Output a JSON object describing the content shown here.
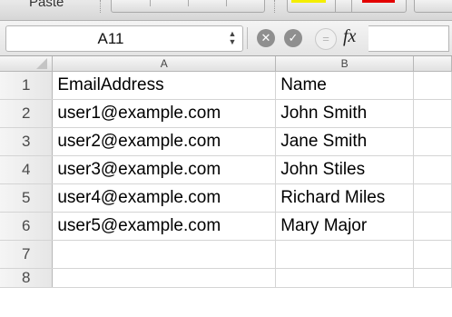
{
  "ribbon": {
    "paste_label": "Paste",
    "swatches": [
      "#f4ee00",
      "#e30000"
    ]
  },
  "formula_bar": {
    "name_box": "A11",
    "icons": [
      "stepper-icon",
      "cancel-icon",
      "enter-icon",
      "equals-icon"
    ],
    "cancel_glyph": "✕",
    "enter_glyph": "✓",
    "equals_glyph": "=",
    "fx_label": "fx",
    "formula_value": ""
  },
  "grid": {
    "columns": [
      "A",
      "B"
    ],
    "rows": [
      {
        "num": "1",
        "cells": [
          "EmailAddress",
          "Name"
        ]
      },
      {
        "num": "2",
        "cells": [
          "user1@example.com",
          "John Smith"
        ]
      },
      {
        "num": "3",
        "cells": [
          "user2@example.com",
          "Jane Smith"
        ]
      },
      {
        "num": "4",
        "cells": [
          "user3@example.com",
          "John Stiles"
        ]
      },
      {
        "num": "5",
        "cells": [
          "user4@example.com",
          "Richard Miles"
        ]
      },
      {
        "num": "6",
        "cells": [
          "user5@example.com",
          "Mary Major"
        ]
      },
      {
        "num": "7",
        "cells": [
          "",
          ""
        ]
      },
      {
        "num": "8",
        "cells": [
          "",
          ""
        ]
      }
    ]
  }
}
